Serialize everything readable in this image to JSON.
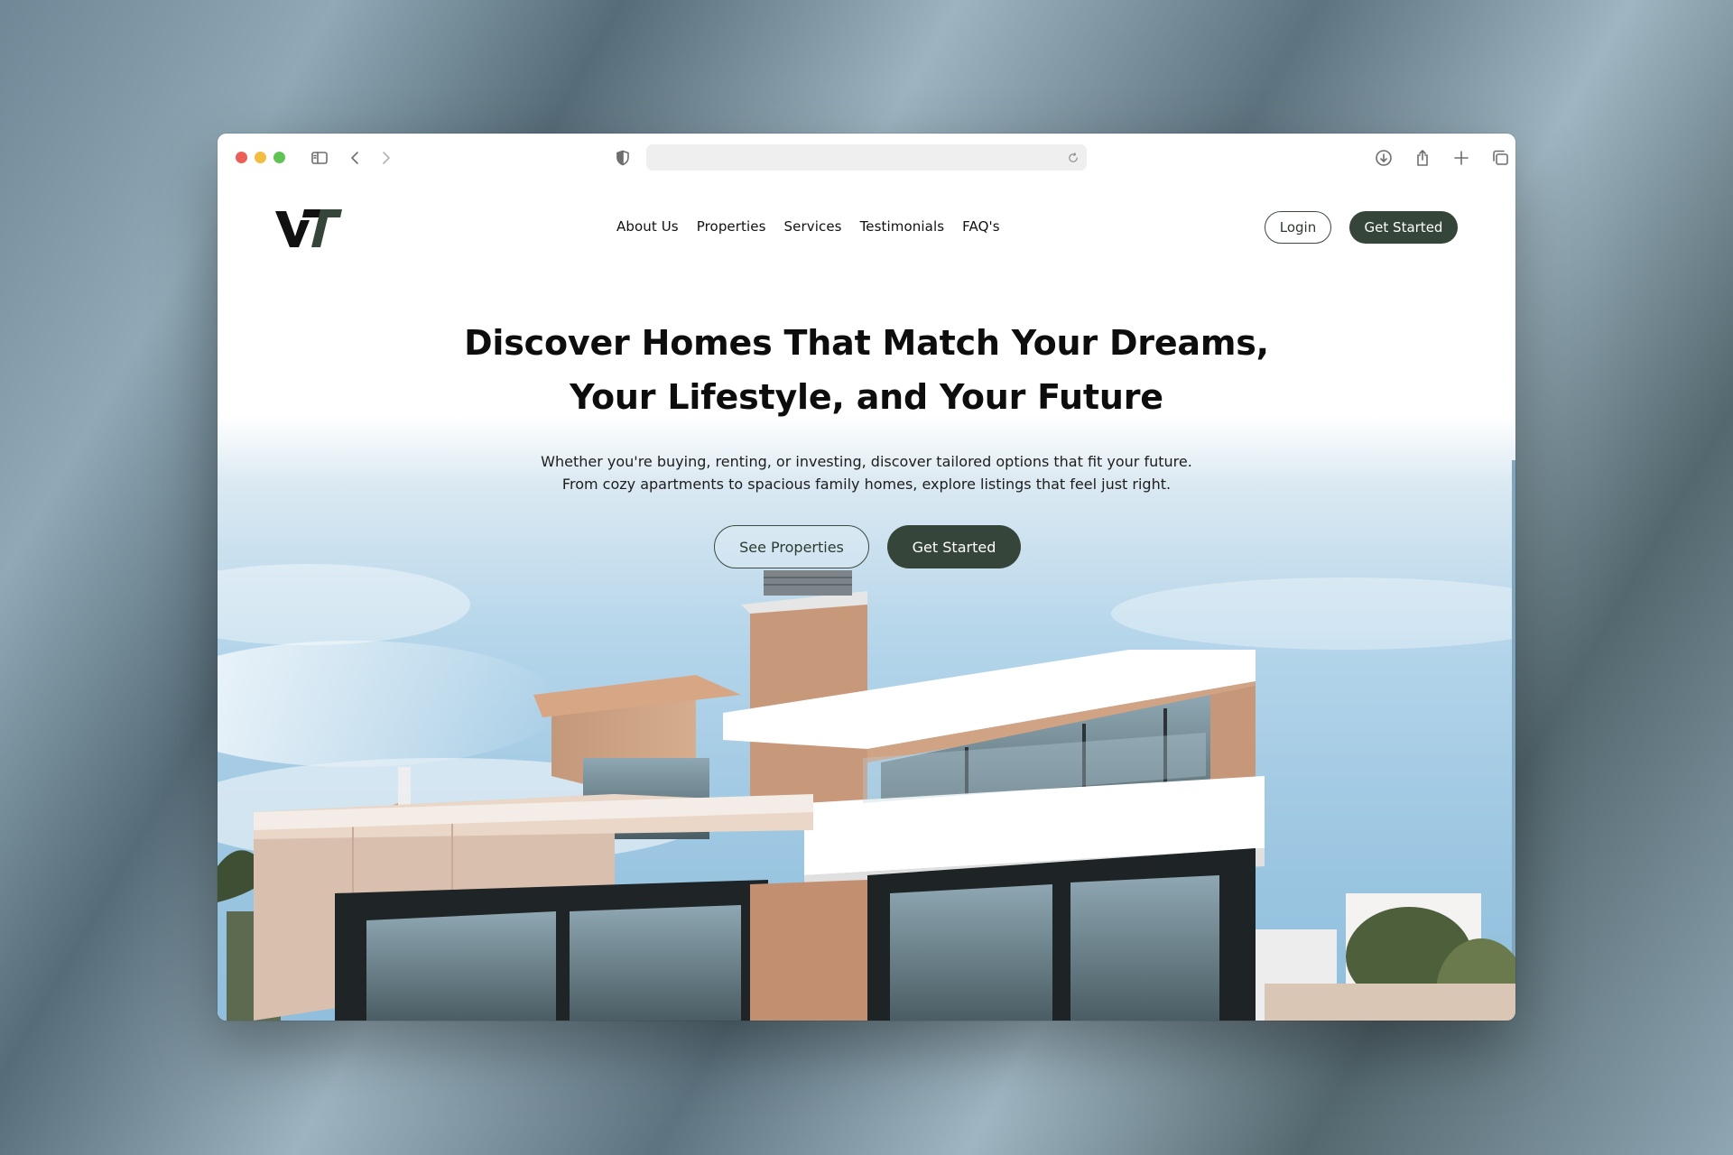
{
  "browser": {
    "url": "",
    "icons": [
      "sidebar-icon",
      "back-icon",
      "forward-icon",
      "shield-icon",
      "reload-icon",
      "download-icon",
      "share-icon",
      "new-tab-icon",
      "tabs-icon"
    ]
  },
  "nav": {
    "logo_text": "VT",
    "links": [
      "About Us",
      "Properties",
      "Services",
      "Testimonials",
      "FAQ's"
    ],
    "login_label": "Login",
    "get_started_label": "Get Started"
  },
  "hero": {
    "headline_line1": "Discover Homes That Match Your Dreams,",
    "headline_line2": "Your Lifestyle, and Your Future",
    "sub_line1": "Whether you're buying, renting, or investing, discover tailored options that fit your future.",
    "sub_line2": "From cozy apartments to spacious family homes, explore listings that feel just right.",
    "see_properties_label": "See Properties",
    "get_started_label": "Get Started"
  },
  "colors": {
    "accent": "#36453a",
    "sky": "#a9cfe6"
  }
}
